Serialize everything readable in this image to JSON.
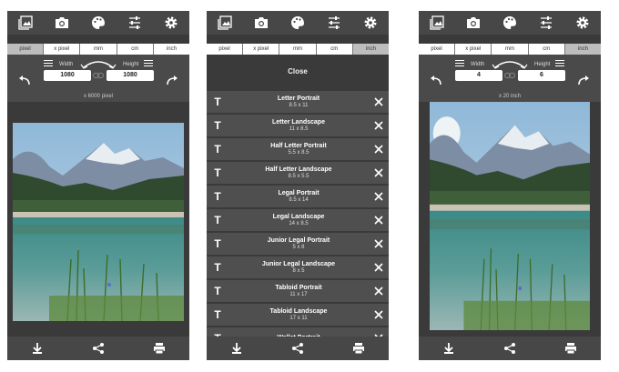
{
  "units": [
    "pixel",
    "x pixel",
    "mm",
    "cm",
    "inch"
  ],
  "screen1": {
    "selected_unit": "pixel",
    "width_label": "Width",
    "height_label": "Height",
    "width_value": "1080",
    "height_value": "1080",
    "subtext": "x 6000 pixel"
  },
  "screen2": {
    "selected_unit": "inch",
    "close_label": "Close",
    "papers": [
      {
        "name": "Letter Portrait",
        "dims": "8.5 x 11"
      },
      {
        "name": "Letter Landscape",
        "dims": "11 x 8.5"
      },
      {
        "name": "Half Letter Portrait",
        "dims": "5.5 x 8.5"
      },
      {
        "name": "Half Letter Landscape",
        "dims": "8.5 x 5.5"
      },
      {
        "name": "Legal Portrait",
        "dims": "8.5 x 14"
      },
      {
        "name": "Legal Landscape",
        "dims": "14 x 8.5"
      },
      {
        "name": "Junior Legal Portrait",
        "dims": "5 x 8"
      },
      {
        "name": "Junior Legal Landscape",
        "dims": "8 x 5"
      },
      {
        "name": "Tabloid Portrait",
        "dims": "11 x 17"
      },
      {
        "name": "Tabloid Landscape",
        "dims": "17 x 11"
      },
      {
        "name": "Wallet Portrait",
        "dims": ""
      }
    ]
  },
  "screen3": {
    "selected_unit": "inch",
    "width_label": "Width",
    "height_label": "Height",
    "width_value": "4",
    "height_value": "6",
    "subtext": "x 20 inch"
  },
  "icons": {
    "top": [
      "gallery-icon",
      "camera-icon",
      "palette-icon",
      "sliders-icon",
      "gear-icon"
    ],
    "bottom": [
      "download-icon",
      "share-icon",
      "print-icon"
    ]
  },
  "colors": {
    "bar": "#474747",
    "screen": "#3a3a3a",
    "row": "#4f4f4f",
    "selected_unit": "#bdbdbd"
  }
}
